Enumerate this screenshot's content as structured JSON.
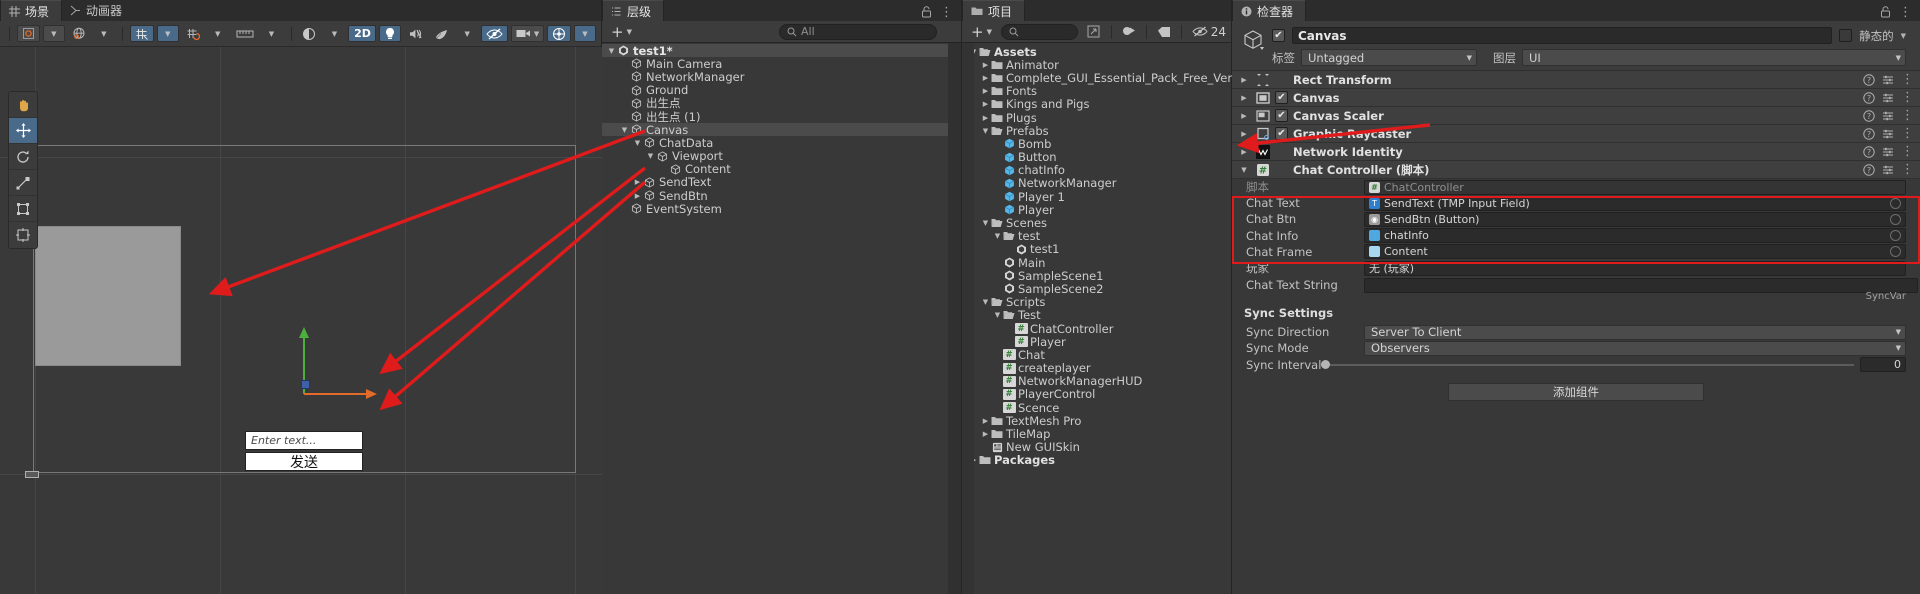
{
  "scene_panel": {
    "tabs": [
      {
        "label": "场景",
        "icon": "grid-icon",
        "active": true
      },
      {
        "label": "动画器",
        "icon": "animator-icon",
        "active": false
      }
    ],
    "toolbar": {
      "pivot_label": "",
      "mode_2d": "2D",
      "gizmo_count": "",
      "buttons": [
        "pivot-toggle",
        "global-toggle",
        "grid-snap",
        "snap-increment",
        "ruler",
        "shading-mode",
        "2d-toggle",
        "lighting-toggle",
        "audio-toggle",
        "fx-toggle",
        "hidden-objects",
        "camera-settings",
        "gizmos-toggle"
      ]
    },
    "tools": [
      "hand-tool",
      "move-tool",
      "rotate-tool",
      "scale-tool",
      "rect-tool",
      "transform-tool"
    ],
    "selected_tool_index": 1,
    "ui_preview": {
      "input_placeholder": "Enter text...",
      "send_button_label": "发送"
    }
  },
  "hierarchy": {
    "tab_label": "层级",
    "add_label": "+",
    "search_placeholder": "All",
    "items": [
      {
        "label": "test1*",
        "depth": 0,
        "expanded": true,
        "icon": "unity-scene-icon",
        "bold": true,
        "selected": false,
        "scene": true
      },
      {
        "label": "Main Camera",
        "depth": 1,
        "expanded": null,
        "icon": "gameobject-icon",
        "selected": false
      },
      {
        "label": "NetworkManager",
        "depth": 1,
        "expanded": null,
        "icon": "gameobject-icon",
        "selected": false
      },
      {
        "label": "Ground",
        "depth": 1,
        "expanded": null,
        "icon": "gameobject-icon",
        "selected": false
      },
      {
        "label": "出生点",
        "depth": 1,
        "expanded": null,
        "icon": "gameobject-icon",
        "selected": false
      },
      {
        "label": "出生点 (1)",
        "depth": 1,
        "expanded": null,
        "icon": "gameobject-icon",
        "selected": false
      },
      {
        "label": "Canvas",
        "depth": 1,
        "expanded": true,
        "icon": "gameobject-icon",
        "selected": true
      },
      {
        "label": "ChatData",
        "depth": 2,
        "expanded": true,
        "icon": "gameobject-icon",
        "selected": false
      },
      {
        "label": "Viewport",
        "depth": 3,
        "expanded": true,
        "icon": "gameobject-icon",
        "selected": false
      },
      {
        "label": "Content",
        "depth": 4,
        "expanded": null,
        "icon": "gameobject-icon",
        "selected": false
      },
      {
        "label": "SendText",
        "depth": 2,
        "expanded": false,
        "icon": "gameobject-icon",
        "selected": false
      },
      {
        "label": "SendBtn",
        "depth": 2,
        "expanded": false,
        "icon": "gameobject-icon",
        "selected": false
      },
      {
        "label": "EventSystem",
        "depth": 1,
        "expanded": null,
        "icon": "gameobject-icon",
        "selected": false
      }
    ]
  },
  "project": {
    "tab_label": "项目",
    "add_label": "+",
    "search_placeholder": "",
    "hidden_count": "24",
    "items": [
      {
        "label": "Assets",
        "depth": 0,
        "expanded": true,
        "icon": "folder-open-icon",
        "bold": true
      },
      {
        "label": "Animator",
        "depth": 1,
        "expanded": false,
        "icon": "folder-icon"
      },
      {
        "label": "Complete_GUI_Essential_Pack_Free_Version",
        "depth": 1,
        "expanded": false,
        "icon": "folder-icon"
      },
      {
        "label": "Fonts",
        "depth": 1,
        "expanded": false,
        "icon": "folder-icon"
      },
      {
        "label": "Kings and Pigs",
        "depth": 1,
        "expanded": false,
        "icon": "folder-icon"
      },
      {
        "label": "Plugs",
        "depth": 1,
        "expanded": false,
        "icon": "folder-icon"
      },
      {
        "label": "Prefabs",
        "depth": 1,
        "expanded": true,
        "icon": "folder-open-icon"
      },
      {
        "label": "Bomb",
        "depth": 2,
        "expanded": null,
        "icon": "prefab-icon"
      },
      {
        "label": "Button",
        "depth": 2,
        "expanded": null,
        "icon": "prefab-icon"
      },
      {
        "label": "chatInfo",
        "depth": 2,
        "expanded": null,
        "icon": "prefab-icon"
      },
      {
        "label": "NetworkManager",
        "depth": 2,
        "expanded": null,
        "icon": "prefab-icon"
      },
      {
        "label": "Player 1",
        "depth": 2,
        "expanded": null,
        "icon": "prefab-icon"
      },
      {
        "label": "Player",
        "depth": 2,
        "expanded": null,
        "icon": "prefab-icon"
      },
      {
        "label": "Scenes",
        "depth": 1,
        "expanded": true,
        "icon": "folder-open-icon"
      },
      {
        "label": "test",
        "depth": 2,
        "expanded": true,
        "icon": "folder-open-icon"
      },
      {
        "label": "test1",
        "depth": 3,
        "expanded": null,
        "icon": "unity-scene-icon"
      },
      {
        "label": "Main",
        "depth": 2,
        "expanded": null,
        "icon": "unity-scene-icon"
      },
      {
        "label": "SampleScene1",
        "depth": 2,
        "expanded": null,
        "icon": "unity-scene-icon"
      },
      {
        "label": "SampleScene2",
        "depth": 2,
        "expanded": null,
        "icon": "unity-scene-icon"
      },
      {
        "label": "Scripts",
        "depth": 1,
        "expanded": true,
        "icon": "folder-open-icon"
      },
      {
        "label": "Test",
        "depth": 2,
        "expanded": true,
        "icon": "folder-open-icon"
      },
      {
        "label": "ChatController",
        "depth": 3,
        "expanded": null,
        "icon": "csharp-script-icon"
      },
      {
        "label": "Player",
        "depth": 3,
        "expanded": null,
        "icon": "csharp-script-icon"
      },
      {
        "label": "Chat",
        "depth": 2,
        "expanded": null,
        "icon": "csharp-script-icon"
      },
      {
        "label": "createplayer",
        "depth": 2,
        "expanded": null,
        "icon": "csharp-script-icon"
      },
      {
        "label": "NetworkManagerHUD",
        "depth": 2,
        "expanded": null,
        "icon": "csharp-script-icon"
      },
      {
        "label": "PlayerControl",
        "depth": 2,
        "expanded": null,
        "icon": "csharp-script-icon"
      },
      {
        "label": "Scence",
        "depth": 2,
        "expanded": null,
        "icon": "csharp-script-icon"
      },
      {
        "label": "TextMesh Pro",
        "depth": 1,
        "expanded": false,
        "icon": "folder-icon"
      },
      {
        "label": "TileMap",
        "depth": 1,
        "expanded": false,
        "icon": "folder-icon"
      },
      {
        "label": "New GUISkin",
        "depth": 1,
        "expanded": null,
        "icon": "guiskin-icon"
      },
      {
        "label": "Packages",
        "depth": 0,
        "expanded": false,
        "icon": "folder-icon",
        "bold": true
      }
    ]
  },
  "inspector": {
    "tab_label": "检查器",
    "lock_icon": "lock-icon",
    "object": {
      "enabled": true,
      "name": "Canvas",
      "static_label": "静态的",
      "static_checked": false,
      "tag_label": "标签",
      "tag_value": "Untagged",
      "layer_label": "图层",
      "layer_value": "UI"
    },
    "components": [
      {
        "name": "Rect Transform",
        "icon": "rect-transform-icon",
        "expanded": false,
        "has_checkbox": false
      },
      {
        "name": "Canvas",
        "icon": "canvas-icon",
        "expanded": false,
        "has_checkbox": true,
        "checked": true
      },
      {
        "name": "Canvas Scaler",
        "icon": "canvas-scaler-icon",
        "expanded": false,
        "has_checkbox": true,
        "checked": true
      },
      {
        "name": "Graphic Raycaster",
        "icon": "graphic-raycaster-icon",
        "expanded": false,
        "has_checkbox": true,
        "checked": true
      },
      {
        "name": "Network Identity",
        "icon": "mirror-icon",
        "expanded": false,
        "has_checkbox": false
      },
      {
        "name": "Chat Controller  (脚本)",
        "icon": "csharp-script-icon",
        "expanded": true,
        "has_checkbox": false
      }
    ],
    "script_row": {
      "label": "脚本",
      "value": "ChatController"
    },
    "fields": [
      {
        "label": "Chat Text",
        "value": "SendText (TMP Input Field)",
        "icon": "tmp-input-icon",
        "icon_color": "#2d7fd0"
      },
      {
        "label": "Chat Btn",
        "value": "SendBtn (Button)",
        "icon": "button-icon",
        "icon_color": "#9a9a9a"
      },
      {
        "label": "Chat Info",
        "value": "chatInfo",
        "icon": "prefab-icon",
        "icon_color": "#4fa8e0"
      },
      {
        "label": "Chat Frame",
        "value": "Content",
        "icon": "gameobject-icon",
        "icon_color": "#a8d8f0"
      }
    ],
    "player_field": {
      "label": "玩家",
      "value": "无 (玩家)"
    },
    "chat_text_string": {
      "label": "Chat Text String",
      "value": "",
      "suffix": "SyncVar"
    },
    "sync_settings": {
      "header": "Sync Settings",
      "rows": [
        {
          "label": "Sync Direction",
          "value": "Server To Client",
          "type": "dropdown"
        },
        {
          "label": "Sync Mode",
          "value": "Observers",
          "type": "dropdown"
        },
        {
          "label": "Sync Interval",
          "value": "0",
          "type": "slider",
          "slider_pct": 0
        }
      ]
    },
    "add_component_label": "添加组件"
  },
  "colors": {
    "accent_blue": "#4a6a8a",
    "annotation_red": "#e01b1b",
    "panel_bg": "#383838",
    "header_bg": "#3c3c3c"
  }
}
